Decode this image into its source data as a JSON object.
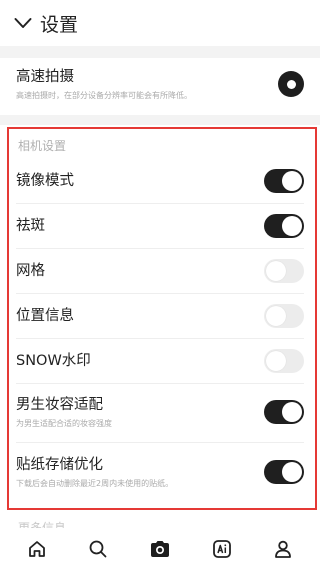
{
  "header": {
    "title": "设置",
    "back_icon": "chevron-down-icon"
  },
  "high_speed": {
    "label": "高速拍摄",
    "desc": "高速拍摄时，在部分设备分辨率可能会有所降低。",
    "selected": true
  },
  "camera_section": {
    "title": "相机设置",
    "items": [
      {
        "label": "镜像模式",
        "desc": "",
        "on": true
      },
      {
        "label": "祛斑",
        "desc": "",
        "on": true
      },
      {
        "label": "网格",
        "desc": "",
        "on": false
      },
      {
        "label": "位置信息",
        "desc": "",
        "on": false
      },
      {
        "label": "SNOW水印",
        "desc": "",
        "on": false
      },
      {
        "label": "男生妆容适配",
        "desc": "为男生适配合适的妆容强度",
        "on": true
      },
      {
        "label": "贴纸存储优化",
        "desc": "下载后会自动删除最近2周内未使用的贴纸。",
        "on": true
      }
    ]
  },
  "next_section": {
    "title": "更多信息"
  },
  "tabbar": {
    "tabs": [
      "home-icon",
      "search-icon",
      "camera-icon",
      "ai-icon",
      "profile-icon"
    ]
  },
  "colors": {
    "toggle_on": "#1f1f1f",
    "toggle_off": "#ececec",
    "highlight_border": "#e53935"
  }
}
